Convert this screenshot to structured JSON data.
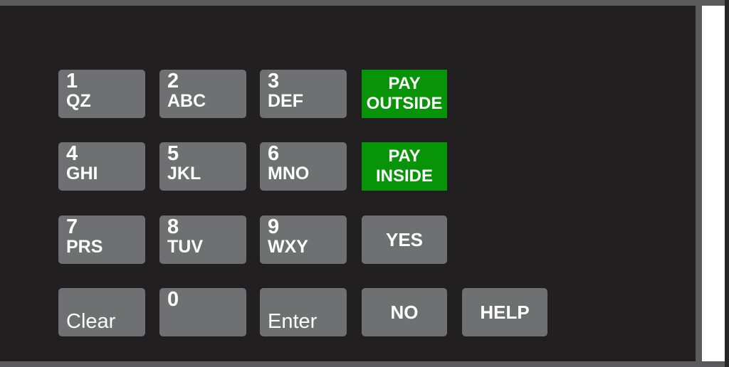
{
  "device": {
    "title": "Fuel Dispenser Payment Keypad Overlay",
    "panel_color": "#221f20",
    "frame_color": "#5a5a5c",
    "key_color": "#6e7072",
    "accent_green": "#089408",
    "text_color": "#ffffff",
    "side_strip_color": "#ffffff"
  },
  "keypad": {
    "rows": [
      {
        "keys": [
          {
            "type": "digit",
            "digit": "1",
            "letters": "QZ"
          },
          {
            "type": "digit",
            "digit": "2",
            "letters": "ABC"
          },
          {
            "type": "digit",
            "digit": "3",
            "letters": "DEF"
          },
          {
            "type": "green",
            "line1": "PAY",
            "line2": "OUTSIDE"
          }
        ]
      },
      {
        "keys": [
          {
            "type": "digit",
            "digit": "4",
            "letters": "GHI"
          },
          {
            "type": "digit",
            "digit": "5",
            "letters": "JKL"
          },
          {
            "type": "digit",
            "digit": "6",
            "letters": "MNO"
          },
          {
            "type": "green",
            "line1": "PAY",
            "line2": "INSIDE"
          }
        ]
      },
      {
        "keys": [
          {
            "type": "digit",
            "digit": "7",
            "letters": "PRS"
          },
          {
            "type": "digit",
            "digit": "8",
            "letters": "TUV"
          },
          {
            "type": "digit",
            "digit": "9",
            "letters": "WXY"
          },
          {
            "type": "center",
            "label": "YES"
          }
        ]
      },
      {
        "keys": [
          {
            "type": "bottomleft",
            "label": "Clear"
          },
          {
            "type": "zero",
            "digit": "0"
          },
          {
            "type": "bottomleft",
            "label": "Enter"
          },
          {
            "type": "center",
            "label": "NO"
          },
          {
            "type": "center",
            "label": "HELP"
          }
        ]
      }
    ]
  },
  "labels": {
    "key_1_digit": "1",
    "key_1_letters": "QZ",
    "key_2_digit": "2",
    "key_2_letters": "ABC",
    "key_3_digit": "3",
    "key_3_letters": "DEF",
    "key_4_digit": "4",
    "key_4_letters": "GHI",
    "key_5_digit": "5",
    "key_5_letters": "JKL",
    "key_6_digit": "6",
    "key_6_letters": "MNO",
    "key_7_digit": "7",
    "key_7_letters": "PRS",
    "key_8_digit": "8",
    "key_8_letters": "TUV",
    "key_9_digit": "9",
    "key_9_letters": "WXY",
    "key_0_digit": "0",
    "pay_outside_line1": "PAY",
    "pay_outside_line2": "OUTSIDE",
    "pay_inside_line1": "PAY",
    "pay_inside_line2": "INSIDE",
    "yes": "YES",
    "no": "NO",
    "help": "HELP",
    "clear": "Clear",
    "enter": "Enter"
  }
}
